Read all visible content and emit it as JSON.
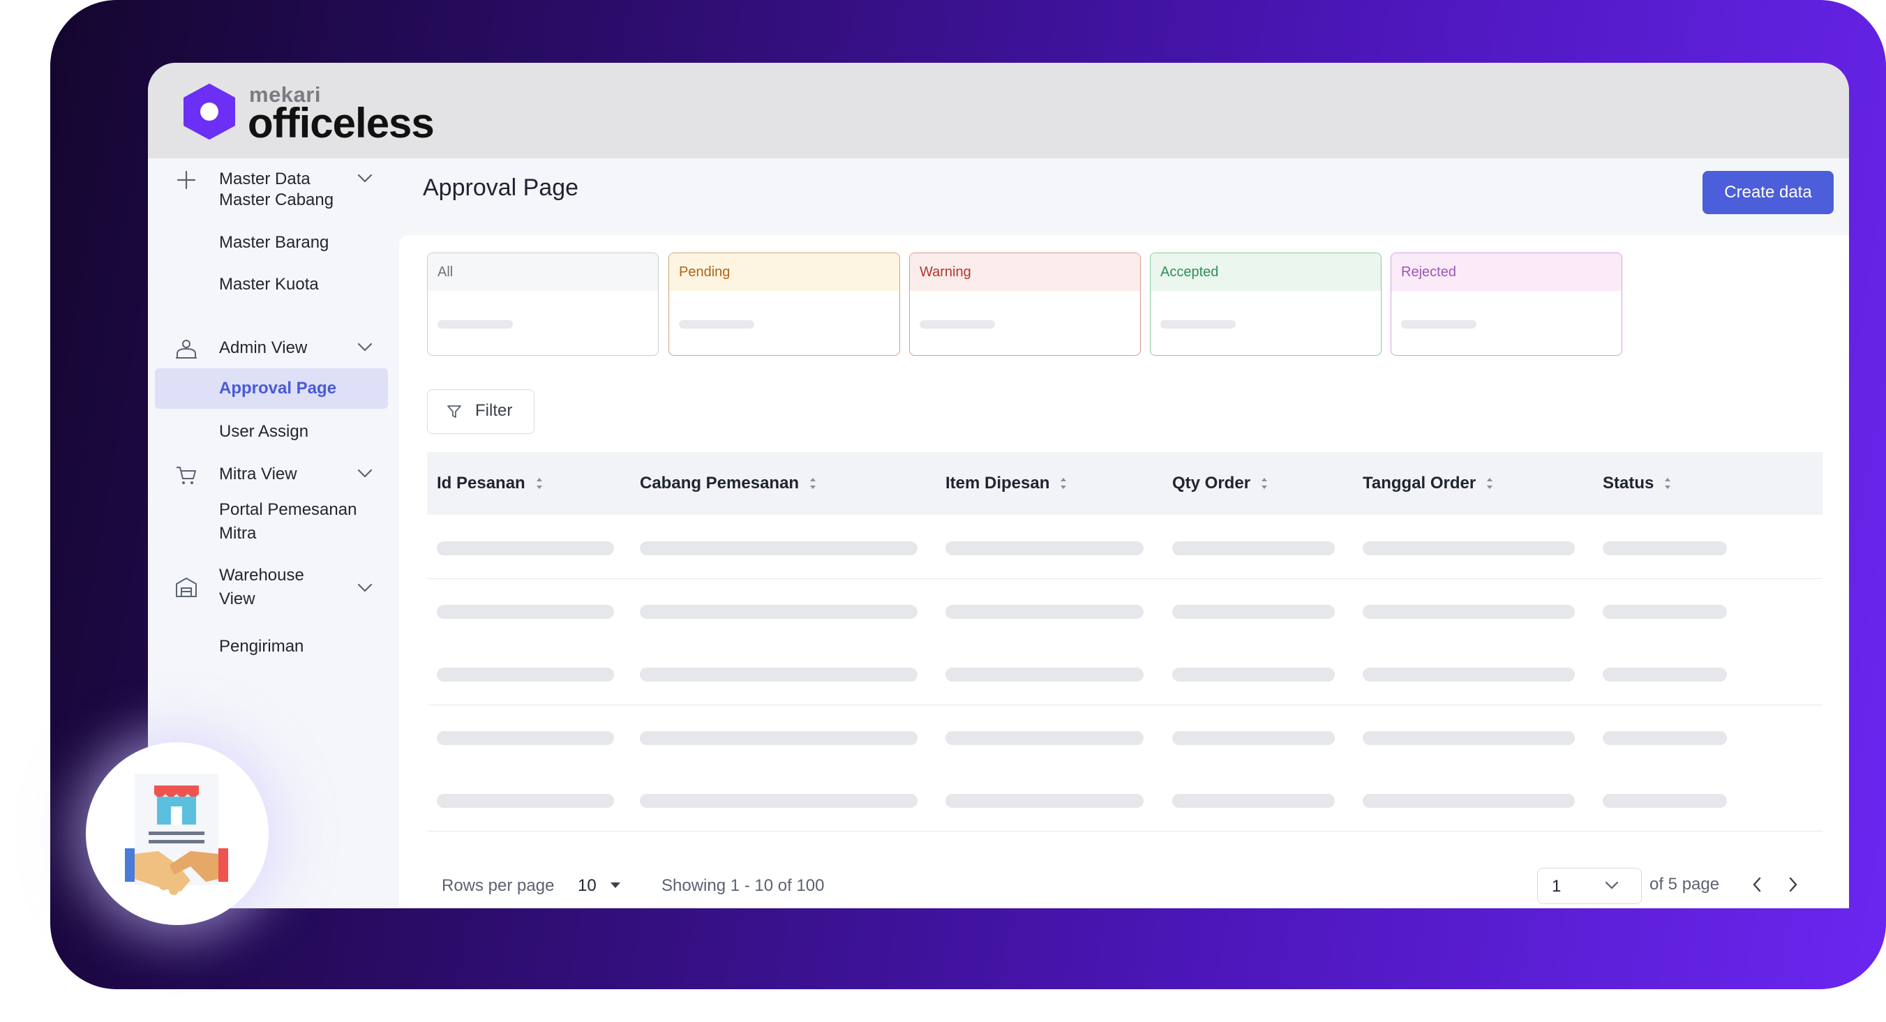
{
  "brand": {
    "small": "mekari",
    "big": "officeless",
    "color": "#6b2ff5"
  },
  "page": {
    "title": "Approval Page",
    "create_label": "Create data"
  },
  "sidebar": {
    "master_data": "Master Data",
    "master_cabang": "Master Cabang",
    "master_barang": "Master Barang",
    "master_kuota": "Master Kuota",
    "admin_view": "Admin View",
    "approval_page": "Approval Page",
    "user_assign": "User Assign",
    "mitra_view": "Mitra View",
    "portal_line1": "Portal Pemesanan",
    "portal_line2": "Mitra",
    "warehouse_line1": "Warehouse",
    "warehouse_line2": "View",
    "pengiriman": "Pengiriman"
  },
  "status_cards": [
    {
      "label": "All",
      "text_color": "#6b7280",
      "border": "#c9ccd3",
      "bg": "#f6f7f9"
    },
    {
      "label": "Pending",
      "text_color": "#b0621a",
      "border": "#d9a27a",
      "bg": "#fdf5e1"
    },
    {
      "label": "Warning",
      "text_color": "#b3352b",
      "border": "#dd9a93",
      "bg": "#fbecec"
    },
    {
      "label": "Accepted",
      "text_color": "#2f8f55",
      "border": "#8dcaa3",
      "bg": "#eaf6ee"
    },
    {
      "label": "Rejected",
      "text_color": "#9b57b8",
      "border": "#cfa1e0",
      "bg": "#fbeaf8"
    }
  ],
  "filter": {
    "label": "Filter"
  },
  "table": {
    "columns": [
      "Id Pesanan",
      "Cabang Pemesanan",
      "Item Dipesan",
      "Qty Order",
      "Tanggal Order",
      "Status"
    ]
  },
  "footer": {
    "rows_label": "Rows per page",
    "rows_value": "10",
    "showing": "Showing 1 - 10 of 100",
    "page_value": "1",
    "of_pages": "of 5 page"
  }
}
